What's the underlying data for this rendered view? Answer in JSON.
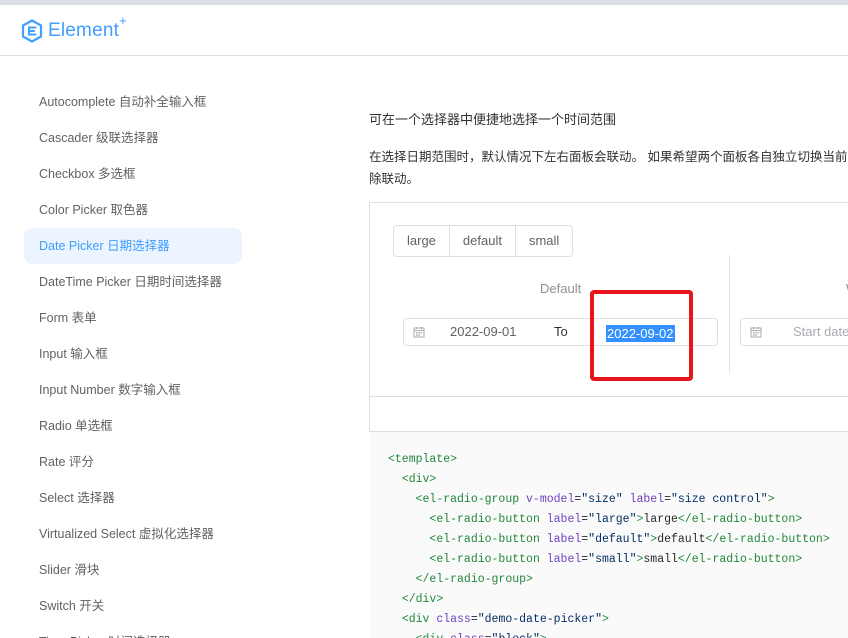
{
  "header": {
    "logo_text": "Element",
    "logo_sup": "+"
  },
  "sidebar": {
    "items": [
      {
        "label": "Autocomplete 自动补全输入框"
      },
      {
        "label": "Cascader 级联选择器"
      },
      {
        "label": "Checkbox 多选框"
      },
      {
        "label": "Color Picker 取色器"
      },
      {
        "label": "Date Picker 日期选择器",
        "active": true
      },
      {
        "label": "DateTime Picker 日期时间选择器"
      },
      {
        "label": "Form 表单"
      },
      {
        "label": "Input 输入框"
      },
      {
        "label": "Input Number 数字输入框"
      },
      {
        "label": "Radio 单选框"
      },
      {
        "label": "Rate 评分"
      },
      {
        "label": "Select 选择器"
      },
      {
        "label": "Virtualized Select 虚拟化选择器"
      },
      {
        "label": "Slider 滑块"
      },
      {
        "label": "Switch 开关"
      },
      {
        "label": "Time Picker 时间选择器"
      }
    ]
  },
  "main": {
    "description": "可在一个选择器中便捷地选择一个时间范围",
    "note_line1": "在选择日期范围时，默认情况下左右面板会联动。 如果希望两个面板各自独立切换当前",
    "note_line2": "除联动。"
  },
  "demo": {
    "sizes": [
      "large",
      "default",
      "small"
    ],
    "block1": {
      "title": "Default",
      "start": "2022-09-01",
      "separator": "To",
      "end": "2022-09-02"
    },
    "block2": {
      "title_partial": "W",
      "start_placeholder": "Start date"
    },
    "highlight_color": "#e8141b",
    "accent": "#409eff"
  },
  "code": {
    "lines": [
      [
        [
          "tag",
          "<template>"
        ]
      ],
      [
        [
          "txt",
          "  "
        ],
        [
          "tag",
          "<div>"
        ]
      ],
      [
        [
          "txt",
          "    "
        ],
        [
          "tag",
          "<el-radio-group "
        ],
        [
          "attr",
          "v-model"
        ],
        [
          "txt",
          "="
        ],
        [
          "str",
          "\"size\""
        ],
        [
          "txt",
          " "
        ],
        [
          "attr",
          "label"
        ],
        [
          "txt",
          "="
        ],
        [
          "str",
          "\"size control\""
        ],
        [
          "tag",
          ">"
        ]
      ],
      [
        [
          "txt",
          "      "
        ],
        [
          "tag",
          "<el-radio-button "
        ],
        [
          "attr",
          "label"
        ],
        [
          "txt",
          "="
        ],
        [
          "str",
          "\"large\""
        ],
        [
          "tag",
          ">"
        ],
        [
          "txt",
          "large"
        ],
        [
          "tag",
          "</el-radio-button>"
        ]
      ],
      [
        [
          "txt",
          "      "
        ],
        [
          "tag",
          "<el-radio-button "
        ],
        [
          "attr",
          "label"
        ],
        [
          "txt",
          "="
        ],
        [
          "str",
          "\"default\""
        ],
        [
          "tag",
          ">"
        ],
        [
          "txt",
          "default"
        ],
        [
          "tag",
          "</el-radio-button>"
        ]
      ],
      [
        [
          "txt",
          "      "
        ],
        [
          "tag",
          "<el-radio-button "
        ],
        [
          "attr",
          "label"
        ],
        [
          "txt",
          "="
        ],
        [
          "str",
          "\"small\""
        ],
        [
          "tag",
          ">"
        ],
        [
          "txt",
          "small"
        ],
        [
          "tag",
          "</el-radio-button>"
        ]
      ],
      [
        [
          "txt",
          "    "
        ],
        [
          "tag",
          "</el-radio-group>"
        ]
      ],
      [
        [
          "txt",
          "  "
        ],
        [
          "tag",
          "</div>"
        ]
      ],
      [
        [
          "txt",
          "  "
        ],
        [
          "tag",
          "<div "
        ],
        [
          "attr",
          "class"
        ],
        [
          "txt",
          "="
        ],
        [
          "str",
          "\"demo-date-picker\""
        ],
        [
          "tag",
          ">"
        ]
      ],
      [
        [
          "txt",
          "    "
        ],
        [
          "tag",
          "<div "
        ],
        [
          "attr",
          "class"
        ],
        [
          "txt",
          "="
        ],
        [
          "str",
          "\"block\""
        ],
        [
          "tag",
          ">"
        ]
      ]
    ]
  }
}
